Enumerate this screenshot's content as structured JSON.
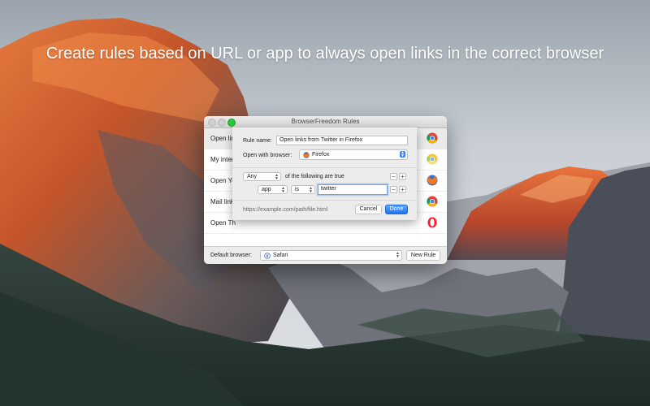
{
  "headline": "Create rules based on URL or app to always open links in the correct browser",
  "window": {
    "title": "BrowserFreedom Rules",
    "rules": [
      {
        "label": "Open lin",
        "browser_icon": "chrome-icon",
        "selected": true
      },
      {
        "label": "My inter",
        "browser_icon": "chrome-canary-icon",
        "selected": false
      },
      {
        "label": "Open Yo",
        "browser_icon": "firefox-icon",
        "selected": false
      },
      {
        "label": "Mail link",
        "browser_icon": "chrome-icon",
        "selected": false
      },
      {
        "label": "Open Th",
        "browser_icon": "opera-icon",
        "selected": false
      }
    ],
    "default_browser_label": "Default browser:",
    "default_browser_value": "Safari",
    "new_rule_label": "New Rule"
  },
  "sheet": {
    "rule_name_label": "Rule name:",
    "rule_name_value": "Open links from Twitter in Firefox",
    "open_with_label": "Open with browser:",
    "open_with_value": "Firefox",
    "match_select": "Any",
    "match_text": "of the following are true",
    "condition_field": "app",
    "condition_operator": "is",
    "condition_value": "twitter",
    "url_preview": "https://example.com/path/file.html",
    "cancel_label": "Cancel",
    "done_label": "Done"
  },
  "colors": {
    "accent": "#1e74f0",
    "zoom_button": "#28c840",
    "focus_ring": "#6ea3e3"
  }
}
